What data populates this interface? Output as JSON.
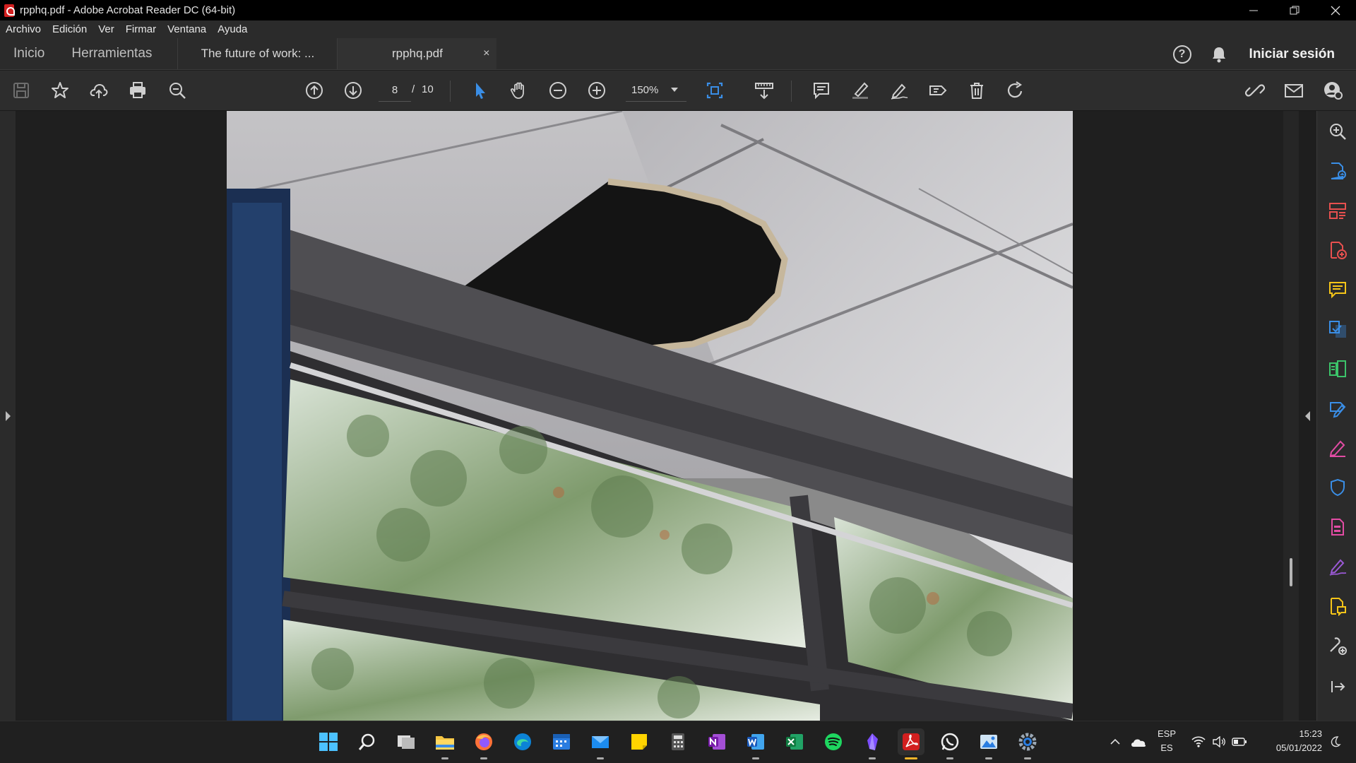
{
  "window": {
    "title": "rpphq.pdf - Adobe Acrobat Reader DC (64-bit)",
    "controls": [
      "minimize",
      "restore",
      "close"
    ]
  },
  "menu": {
    "items": [
      "Archivo",
      "Edición",
      "Ver",
      "Firmar",
      "Ventana",
      "Ayuda"
    ]
  },
  "tabs": {
    "home": "Inicio",
    "tools": "Herramientas",
    "documents": [
      {
        "label": "The future of work: ...",
        "active": false
      },
      {
        "label": "rpphq.pdf",
        "active": true
      }
    ],
    "close_glyph": "×",
    "help_glyph": "?",
    "signin": "Iniciar sesión"
  },
  "toolbar": {
    "page_current": "8",
    "page_separator": "/",
    "page_total": "10",
    "zoom": "150%",
    "icons": [
      "save-icon",
      "star-icon",
      "cloud-upload-icon",
      "print-icon",
      "zoom-search-icon",
      "page-up-icon",
      "page-down-icon",
      "select-arrow-icon",
      "hand-icon",
      "zoom-out-icon",
      "zoom-in-icon",
      "fit-page-icon",
      "scroll-mode-icon",
      "comment-icon",
      "highlight-icon",
      "draw-icon",
      "stamp-icon",
      "delete-icon",
      "rotate-icon",
      "share-link-icon",
      "mail-icon",
      "account-icon"
    ]
  },
  "right_panel": {
    "icons": [
      "search-zoom-icon",
      "export-pdf-icon",
      "organize-pages-icon",
      "create-pdf-icon",
      "comment-icon",
      "combine-files-icon",
      "compress-icon",
      "edit-pdf-icon",
      "fill-sign-icon",
      "protect-icon",
      "redact-icon",
      "request-signature-icon",
      "send-review-icon",
      "more-tools-icon",
      "collapse-icon"
    ],
    "colors": {
      "blue": "#3a8ee6",
      "green": "#3cc46a",
      "red": "#e8504f",
      "yellow": "#f5c518",
      "pink": "#e24ca4",
      "purple": "#9b59d6"
    }
  },
  "taskbar": {
    "apps": [
      "windows-start-icon",
      "search-icon",
      "task-view-icon",
      "file-explorer-icon",
      "firefox-icon",
      "edge-icon",
      "calendar-icon",
      "mail-icon",
      "sticky-notes-icon",
      "calculator-icon",
      "onenote-icon",
      "word-icon",
      "excel-icon",
      "spotify-icon",
      "obsidian-icon",
      "acrobat-icon",
      "whatsapp-icon",
      "photos-icon",
      "settings-icon"
    ],
    "language_top": "ESP",
    "language_bottom": "ES",
    "time": "15:23",
    "date": "05/01/2022"
  }
}
